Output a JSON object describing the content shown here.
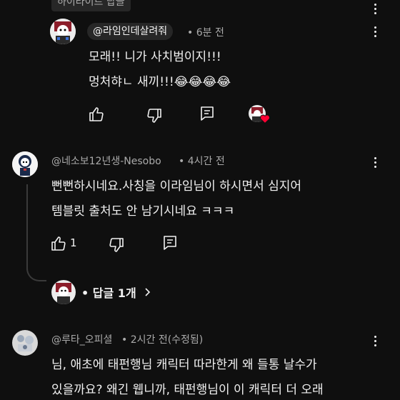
{
  "top_pill": {
    "label": "하이라이트 답글"
  },
  "comments": [
    {
      "handle": "@라임인데살려줘",
      "time": "• 6분 전",
      "lines": [
        "모래!! 니가 사치범이지!!!",
        "멍처햐ㄴ 새끼!!!😂😂😂😂"
      ],
      "like_count": ""
    },
    {
      "handle": "@네소보12년생-Nesobo",
      "time": "• 4시간 전",
      "lines": [
        "뻔뻔하시네요.사칭을 이라임님이 하시면서 심지어",
        "템블릿 출처도 안 남기시네요 ㅋㅋㅋ"
      ],
      "like_count": "1"
    },
    {
      "handle": "@루타_오피셜",
      "time": "• 2시간 전(수정됨)",
      "lines": [
        "님, 애초에 태펀행님 캐릭터 따라한게 왜 들통 날수가",
        "있을까요? 왜긴 웹니까, 태펀행님이 이 캐릭터 더 오래"
      ],
      "like_count": ""
    }
  ],
  "replies": {
    "label": "• 답글 1개"
  },
  "icons": {
    "like": "thumbs-up-icon",
    "dislike": "thumbs-down-icon",
    "reply": "reply-icon",
    "more": "more-vertical-icon",
    "chevron": "chevron-right-icon",
    "heart": "creator-heart-icon"
  },
  "colors": {
    "background": "#0f0f0f",
    "text": "#f1f1f1",
    "muted": "#aaaaaa",
    "chip": "#272727",
    "heart": "#ff0033"
  }
}
